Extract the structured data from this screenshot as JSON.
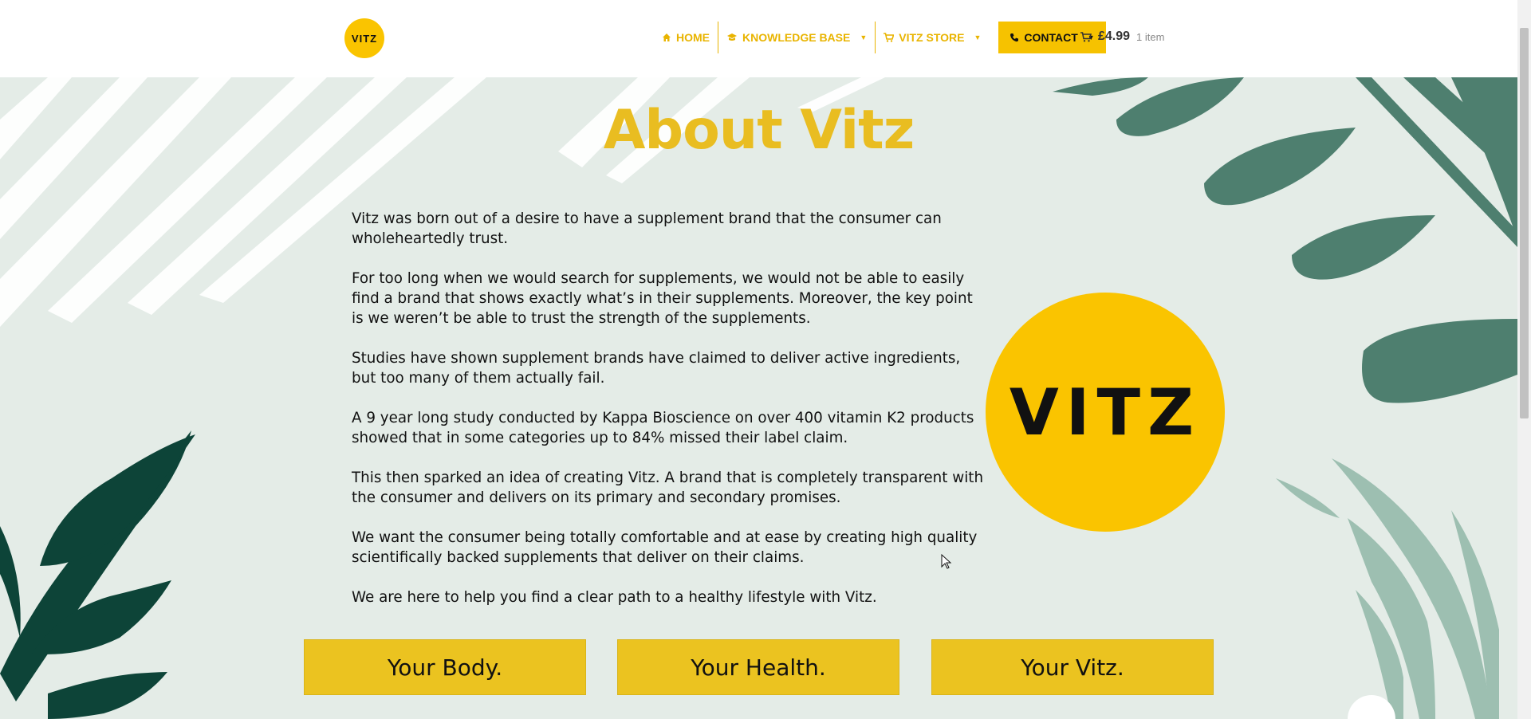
{
  "header": {
    "logo_text": "VITZ",
    "nav": [
      {
        "label": "HOME",
        "icon": "home-icon"
      },
      {
        "label": "KNOWLEDGE BASE",
        "icon": "graduation-cap-icon",
        "dropdown": true
      },
      {
        "label": "VITZ STORE",
        "icon": "cart-icon",
        "dropdown": true
      },
      {
        "label": "CONTACT",
        "icon": "phone-icon",
        "dropdown": true
      }
    ],
    "cart": {
      "price": "£4.99",
      "items": "1 item"
    }
  },
  "main": {
    "title": "About Vitz",
    "paragraphs": [
      "Vitz was born out of a desire to have a supplement brand that the consumer can wholeheartedly trust.",
      "For too long when we would search for supplements, we would not be able to easily find a brand that shows exactly what’s in their supplements. Moreover, the key point is we weren’t be able to trust the strength of the supplements.",
      "Studies have shown supplement brands have claimed to deliver active ingredients, but too many of them actually fail.",
      "A 9 year long study conducted by Kappa Bioscience on over 400 vitamin K2 products showed that in some categories up to 84% missed their label claim.",
      "This then sparked an idea of creating Vitz. A brand that is completely transparent with the consumer and delivers on its primary and secondary promises.",
      "We want the consumer being totally comfortable and at ease by creating high quality scientifically backed supplements that deliver on their claims.",
      "We are here to help you find a clear path to a healthy lifestyle with Vitz."
    ],
    "badge_text": "VITZ",
    "buttons": [
      "Your Body.",
      "Your Health.",
      "Your Vitz."
    ]
  },
  "colors": {
    "accent": "#fac400",
    "title": "#e9bd21",
    "background": "#e4ece7",
    "leaf_dark": "#0d4438",
    "leaf_mid": "#4e7f6f",
    "leaf_light": "#9dbfb1"
  }
}
